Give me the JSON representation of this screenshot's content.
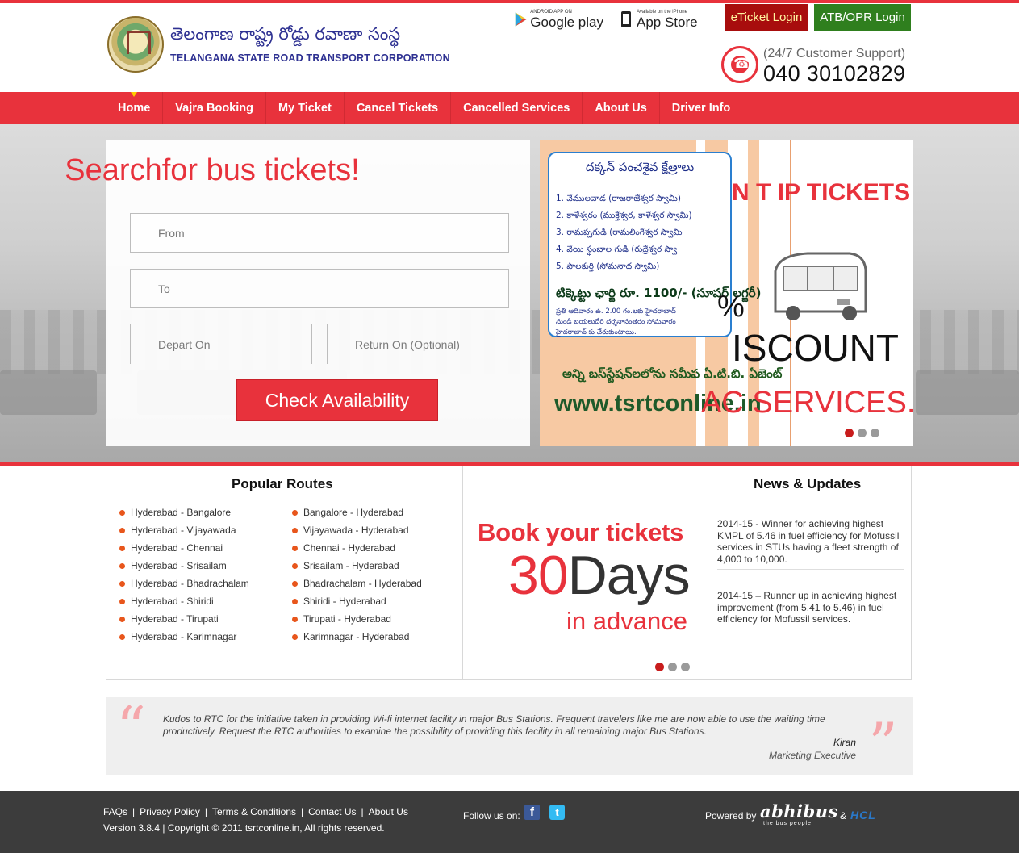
{
  "header": {
    "logo_telugu": "తెలంగాణ  రాష్ట్ర రోడ్డు రవాణా సంస్థ",
    "logo_english": "TELANGANA STATE ROAD TRANSPORT CORPORATION",
    "google_play_small": "ANDROID APP ON",
    "google_play_big": "Google play",
    "app_store_small": "Available on the iPhone",
    "app_store_big": "App Store",
    "eticket_login": "eTicket Login",
    "atb_login": "ATB/OPR Login",
    "support_label": "(24/7 Customer Support)",
    "support_phone": "040 30102829"
  },
  "nav": {
    "items": [
      {
        "label": "Home",
        "active": true
      },
      {
        "label": "Vajra Booking"
      },
      {
        "label": "My Ticket"
      },
      {
        "label": "Cancel Tickets"
      },
      {
        "label": "Cancelled Services"
      },
      {
        "label": "About Us"
      },
      {
        "label": "Driver Info"
      }
    ]
  },
  "search": {
    "title": "Searchfor bus tickets!",
    "from_placeholder": "From",
    "to_placeholder": "To",
    "depart_placeholder": "Depart On",
    "return_placeholder": "Return On (Optional)",
    "submit_label": "Check Availability"
  },
  "promo": {
    "box_title": "దక్కన్ పంచశైవ క్షేత్రాలు",
    "items": [
      "1. వేములవాడ (రాజరాజేశ్వర స్వామి)",
      "2. కాళేశ్వరం (ముక్తేశ్వర, కాళేశ్వర స్వామి)",
      "3. రామప్పగుడి (రామలింగేశ్వర స్వామి",
      "4. వేయి స్థంబాల గుడి (రుద్రేశ్వర స్వా",
      "5. పాలకుర్తి (సోమనాథ స్వామి)"
    ],
    "price": "టిక్కెట్టు ఛార్జి రూ. 1100/- (సూపర్ లగ్జరీ)",
    "note_1": "ప్రతి ఆదివారం ఉ. 2.00 గం.లకు హైదరాబాద్",
    "note_2": "నుండి బయలుదేరి దర్శనానంతరం సోమవారం",
    "note_3": "హైదరాబాద్ కు చేరుకుంటాయి.",
    "stations": "అన్ని బస్‌స్టేషన్‌లలోను సమీప ఏ.టి.బి. ఏజెంట్",
    "website": "www.tsrtconline.in",
    "overlay_trip": "N  T  IP  TICKETS",
    "overlay_discount": "ISCOUNT",
    "overlay_services": "AC SERVICES.",
    "overlay_percent": "%",
    "slides": 3,
    "active_slide": 0
  },
  "routes": {
    "title": "Popular Routes",
    "col1": [
      "Hyderabad - Bangalore",
      "Hyderabad - Vijayawada",
      "Hyderabad - Chennai",
      "Hyderabad - Srisailam",
      "Hyderabad - Bhadrachalam",
      "Hyderabad - Shiridi",
      "Hyderabad - Tirupati",
      "Hyderabad - Karimnagar"
    ],
    "col2": [
      "Bangalore - Hyderabad",
      "Vijayawada - Hyderabad",
      "Chennai - Hyderabad",
      "Srisailam - Hyderabad",
      "Bhadrachalam - Hyderabad",
      "Shiridi - Hyderabad",
      "Tirupati - Hyderabad",
      "Karimnagar - Hyderabad"
    ]
  },
  "advance": {
    "line1": "Book your tickets",
    "number": "30",
    "days": "Days",
    "line3": "in advance",
    "slides": 3,
    "active_slide": 0
  },
  "news": {
    "title": "News & Updates",
    "items": [
      "2014-15 - Winner for achieving highest KMPL of 5.46 in fuel efficiency for Mofussil services in STUs having a fleet strength of 4,000 to 10,000.",
      "2014-15 – Runner up in achieving highest improvement (from 5.41 to 5.46) in fuel efficiency for Mofussil services."
    ]
  },
  "testimonial": {
    "text": "Kudos to RTC for the initiative taken in providing Wi-fi internet facility in major Bus Stations. Frequent travelers like me are now able to use the waiting time productively. Request the RTC authorities to examine the possibility of providing this facility in all remaining major Bus Stations.",
    "author": "Kiran",
    "role": "Marketing Executive"
  },
  "footer": {
    "links": [
      "FAQs",
      "Privacy Policy",
      "Terms & Conditions",
      "Contact Us",
      "About Us"
    ],
    "copyright": "Version 3.8.4 | Copyright © 2011 tsrtconline.in, All rights reserved.",
    "follow_label": "Follow us on:",
    "powered_label": "Powered by",
    "abhibus": "abhibus",
    "abhibus_tagline": "the bus people",
    "amp": "&",
    "hcl": "HCL"
  },
  "colors": {
    "accent": "#e8323c",
    "eticket_bg": "#a80d0d",
    "atb_bg": "#2f7f1e",
    "footer_bg": "#3c3c3c"
  }
}
